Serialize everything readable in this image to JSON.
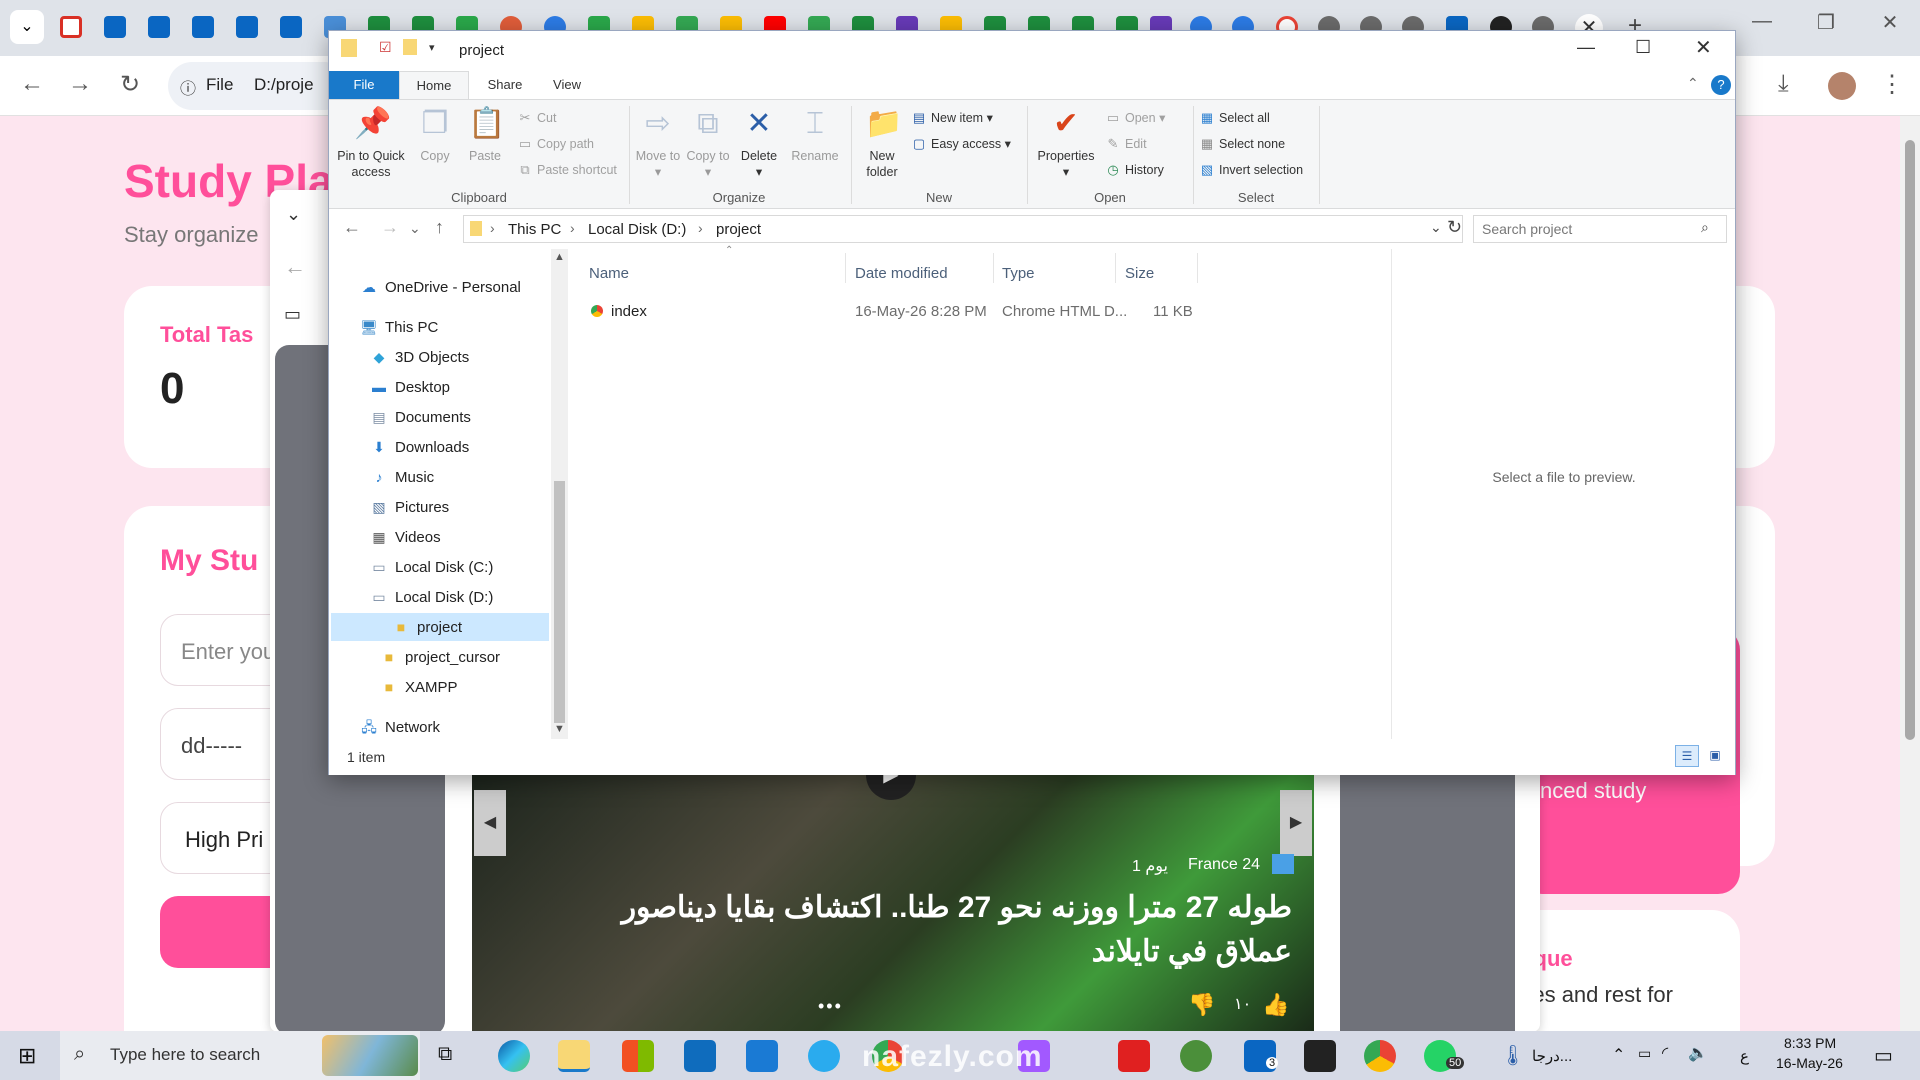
{
  "browser": {
    "address_scheme": "File",
    "address_text": "D:/proje",
    "tab_close": "✕",
    "new_tab": "+"
  },
  "webpage": {
    "title": "Study Pla",
    "subtitle": "Stay organize",
    "total_tasks_label": "Total Tas",
    "total_tasks_value": "0",
    "my_study_label": "My Stu",
    "input_placeholder": "Enter you",
    "date_placeholder": "dd-----",
    "priority_value": "High Pri",
    "right_card_text": "nced study",
    "technique_label": "nique",
    "technique_text": "utes and rest for"
  },
  "video_overlay": {
    "source": "France 24",
    "age": "1 يوم",
    "headline_line1": "طوله 27 مترا ووزنه نحو 27 طنا.. اكتشاف بقايا ديناصور",
    "headline_line2": "عملاق في تايلاند",
    "like_count": "١٠",
    "watermark": "nafezly.com"
  },
  "explorer": {
    "title": "project",
    "tabs": [
      "File",
      "Home",
      "Share",
      "View"
    ],
    "clipboard": {
      "pin": "Pin to Quick access",
      "copy": "Copy",
      "paste": "Paste",
      "cut": "Cut",
      "copy_path": "Copy path",
      "paste_shortcut": "Paste shortcut",
      "label": "Clipboard"
    },
    "organize": {
      "move_to": "Move to",
      "copy_to": "Copy to",
      "delete": "Delete",
      "rename": "Rename",
      "label": "Organize"
    },
    "new": {
      "new_folder": "New folder",
      "new_item": "New item",
      "easy_access": "Easy access",
      "label": "New"
    },
    "open": {
      "properties": "Properties",
      "open": "Open",
      "edit": "Edit",
      "history": "History",
      "label": "Open"
    },
    "select": {
      "select_all": "Select all",
      "select_none": "Select none",
      "invert": "Invert selection",
      "label": "Select"
    },
    "breadcrumb": [
      "This PC",
      "Local Disk (D:)",
      "project"
    ],
    "search_placeholder": "Search project",
    "nav": {
      "onedrive": "OneDrive - Personal",
      "this_pc": "This PC",
      "objects3d": "3D Objects",
      "desktop": "Desktop",
      "documents": "Documents",
      "downloads": "Downloads",
      "music": "Music",
      "pictures": "Pictures",
      "videos": "Videos",
      "disk_c": "Local Disk (C:)",
      "disk_d": "Local Disk (D:)",
      "project": "project",
      "project_cursor": "project_cursor",
      "xampp": "XAMPP",
      "network": "Network"
    },
    "columns": [
      "Name",
      "Date modified",
      "Type",
      "Size"
    ],
    "files": [
      {
        "name": "index",
        "date": "16-May-26 8:28 PM",
        "type": "Chrome HTML D...",
        "size": "11 KB"
      }
    ],
    "preview_text": "Select a file to preview.",
    "status": "1 item"
  },
  "taskbar": {
    "search_placeholder": "Type here to search",
    "time": "8:33 PM",
    "date": "16-May-26",
    "tray_text": "درجا...",
    "lang": "ع",
    "badge_li": "3",
    "badge_wa": "50"
  }
}
